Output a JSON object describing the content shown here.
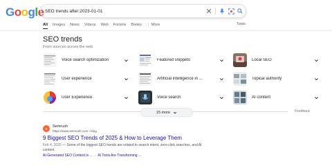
{
  "logo": "Google",
  "search": {
    "query": "SEO trends after:2023-01-01"
  },
  "tabs": [
    {
      "label": "All",
      "active": true
    },
    {
      "label": "Images"
    },
    {
      "label": "News"
    },
    {
      "label": "Videos"
    },
    {
      "label": "Web"
    },
    {
      "label": "Forums"
    },
    {
      "label": "Books"
    },
    {
      "label": "⋮ More"
    }
  ],
  "tools_label": "Tools",
  "trends": {
    "title": "SEO trends",
    "subtitle": "From sources across the web",
    "items": [
      {
        "label": "Voice search optimization",
        "thumb": "doc-thumb"
      },
      {
        "label": "Featured snippets",
        "thumb": "snippet-thumb"
      },
      {
        "label": "Local SEO",
        "thumb": "local-thumb"
      },
      {
        "label": "User experience",
        "thumb": "ux-thumb"
      },
      {
        "label": "Artificial intelligence in ...",
        "thumb": "ai-thumb"
      },
      {
        "label": "Topical authority",
        "thumb": "topical-thumb"
      },
      {
        "label": "User Experience",
        "thumb": "ux2-thumb"
      },
      {
        "label": "Voice search",
        "thumb": "voice-thumb"
      },
      {
        "label": "AI content",
        "thumb": "aicontent-thumb"
      }
    ],
    "more_label": "15 more",
    "feedback_label": "Feedback"
  },
  "result": {
    "favicon_text": "S",
    "site_name": "Semrush",
    "site_url": "https://www.semrush.com › blog",
    "title": "9 Biggest SEO Trends of 2025 & How to Leverage Them",
    "date": "Feb 4, 2025",
    "snippet": "Some of the biggest SEO trends are related to search intent, zero-click searches, and AI content.",
    "sublinks": [
      "AI-Generated SEO Content Is ...",
      "AI Tools Are Transforming ..."
    ]
  },
  "colors": {
    "link": "#1a0dab",
    "accent_blue": "#4285f4"
  }
}
